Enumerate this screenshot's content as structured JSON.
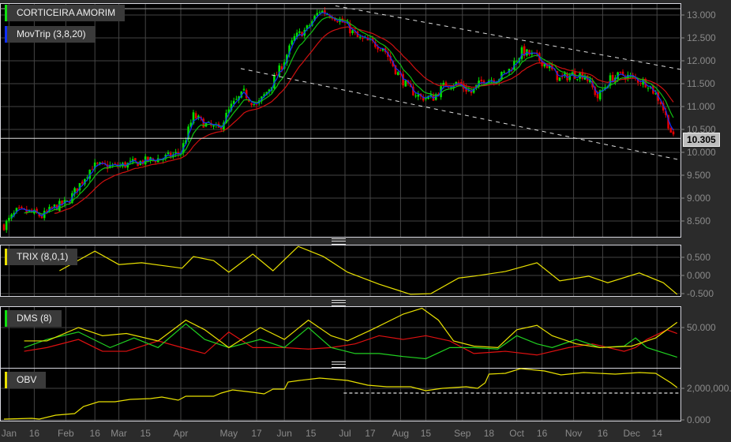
{
  "legends": {
    "main": "CORTICEIRA AMORIM",
    "movtrip": "MovTrip (3,8,20)",
    "trix": "TRIX (8,0,1)",
    "dms": "DMS (8)",
    "obv": "OBV"
  },
  "last_price": "10.305",
  "colors": {
    "up": "#00e000",
    "down": "#e00000",
    "ema_fast": "#1030ff",
    "ema_mid": "#10c010",
    "ema_slow": "#d01010",
    "trix": "#e8e000",
    "dms_plus": "#20d020",
    "dms_minus": "#e01010",
    "adx": "#e8e000",
    "obv": "#e8e000"
  },
  "chart_data": [
    {
      "type": "candlestick",
      "title": "CORTICEIRA AMORIM",
      "x_unit": "week",
      "ylim": [
        8.2,
        13.3
      ],
      "yticks": [
        "13.000",
        "12.500",
        "12.000",
        "11.500",
        "11.000",
        "10.500",
        "10.000",
        "9.500",
        "9.000",
        "8.500"
      ],
      "ytick_values": [
        13,
        12.5,
        12,
        11.5,
        11,
        10.5,
        10,
        9.5,
        9,
        8.5
      ],
      "xticks": [
        "Jan",
        "16",
        "Feb",
        "16",
        "Mar",
        "15",
        "Apr",
        "May",
        "17",
        "Jun",
        "15",
        "Jul",
        "17",
        "Aug",
        "15",
        "Sep",
        "18",
        "Oct",
        "16",
        "Nov",
        "16",
        "Dec",
        "14"
      ],
      "xtick_weeks": [
        0.4,
        2.4,
        4.9,
        7.2,
        9.1,
        11.2,
        14,
        17.8,
        20,
        22.2,
        24.3,
        27,
        29,
        31.4,
        33.4,
        36.3,
        38.4,
        40.6,
        42.6,
        45.1,
        47.4,
        49.7,
        51.7
      ],
      "weekly_close": [
        8.4,
        8.7,
        8.7,
        8.6,
        8.8,
        8.9,
        9.3,
        9.7,
        9.7,
        9.7,
        9.75,
        9.8,
        9.85,
        9.9,
        10.0,
        10.8,
        10.6,
        10.5,
        11.0,
        11.3,
        11.0,
        11.4,
        11.9,
        12.5,
        12.7,
        13.1,
        13.0,
        12.8,
        12.5,
        12.4,
        12.3,
        11.8,
        11.4,
        11.2,
        11.2,
        11.5,
        11.5,
        11.3,
        11.6,
        11.6,
        11.8,
        12.2,
        12.1,
        11.9,
        11.6,
        11.7,
        11.7,
        11.2,
        11.6,
        11.7,
        11.6,
        11.5,
        11.1,
        10.3
      ],
      "moving_averages": [
        "EMA 3",
        "EMA 8",
        "EMA 20"
      ],
      "trendlines": [
        {
          "name": "upper",
          "from": [
            26.25,
            13.2
          ],
          "to": [
            53.6,
            11.81
          ]
        },
        {
          "name": "lower",
          "from": [
            18.75,
            11.83
          ],
          "to": [
            53.6,
            9.83
          ]
        }
      ]
    },
    {
      "type": "line",
      "title": "TRIX (8,0,1)",
      "ylim": [
        -0.55,
        0.85
      ],
      "yticks": [
        "0.500",
        "0.000",
        "-0.500"
      ],
      "ytick_values": [
        0.5,
        0,
        -0.5
      ],
      "points": [
        [
          4.4,
          0.13
        ],
        [
          7.2,
          0.67
        ],
        [
          9.1,
          0.3
        ],
        [
          10.9,
          0.35
        ],
        [
          14.1,
          0.2
        ],
        [
          15,
          0.52
        ],
        [
          16.6,
          0.41
        ],
        [
          17.8,
          0.09
        ],
        [
          19.7,
          0.59
        ],
        [
          21.3,
          0.13
        ],
        [
          23.3,
          0.8
        ],
        [
          25.3,
          0.52
        ],
        [
          27.2,
          0.09
        ],
        [
          29.7,
          -0.24
        ],
        [
          32.2,
          -0.52
        ],
        [
          33.8,
          -0.5
        ],
        [
          36,
          -0.07
        ],
        [
          37.2,
          -0.02
        ],
        [
          39.7,
          0.11
        ],
        [
          42.2,
          0.35
        ],
        [
          44,
          -0.15
        ],
        [
          46.3,
          -0.02
        ],
        [
          47.8,
          -0.2
        ],
        [
          50.3,
          0.07
        ],
        [
          52.2,
          -0.2
        ],
        [
          53.3,
          -0.52
        ]
      ]
    },
    {
      "type": "line",
      "title": "DMS (8)",
      "ylim": [
        0,
        78
      ],
      "yticks": [
        "50.000"
      ],
      "ytick_values": [
        50
      ],
      "series": [
        {
          "name": "ADX",
          "points": [
            [
              1.6,
              32
            ],
            [
              3.4,
              32
            ],
            [
              5.9,
              50
            ],
            [
              7.8,
              39
            ],
            [
              9.7,
              42
            ],
            [
              12.2,
              32
            ],
            [
              14.4,
              60
            ],
            [
              15.9,
              47
            ],
            [
              17.8,
              23
            ],
            [
              20.3,
              50
            ],
            [
              22.2,
              34
            ],
            [
              24.1,
              60
            ],
            [
              25.9,
              39
            ],
            [
              27.2,
              32
            ],
            [
              29.1,
              47
            ],
            [
              31.6,
              68
            ],
            [
              33.1,
              76
            ],
            [
              34.4,
              60
            ],
            [
              35.6,
              32
            ],
            [
              37.2,
              25
            ],
            [
              39.1,
              23
            ],
            [
              40.6,
              47
            ],
            [
              42.2,
              53
            ],
            [
              43.4,
              39
            ],
            [
              45.3,
              28
            ],
            [
              47.2,
              23
            ],
            [
              49.7,
              25
            ],
            [
              51.6,
              36
            ],
            [
              53.3,
              57
            ]
          ]
        },
        {
          "name": "+DI",
          "points": [
            [
              1.6,
              23
            ],
            [
              3.4,
              34
            ],
            [
              5.9,
              44
            ],
            [
              8.4,
              23
            ],
            [
              10.3,
              36
            ],
            [
              12.2,
              23
            ],
            [
              14.4,
              55
            ],
            [
              15.9,
              34
            ],
            [
              17.8,
              23
            ],
            [
              20.3,
              34
            ],
            [
              22.2,
              23
            ],
            [
              24.1,
              50
            ],
            [
              25.9,
              23
            ],
            [
              27.8,
              15
            ],
            [
              29.7,
              15
            ],
            [
              31.6,
              11
            ],
            [
              33.4,
              8
            ],
            [
              35.3,
              23
            ],
            [
              37.2,
              23
            ],
            [
              39.1,
              21
            ],
            [
              40.6,
              39
            ],
            [
              42.2,
              28
            ],
            [
              43.4,
              23
            ],
            [
              45.3,
              34
            ],
            [
              47.2,
              23
            ],
            [
              49.1,
              25
            ],
            [
              50,
              36
            ],
            [
              50.9,
              23
            ],
            [
              53.3,
              10
            ]
          ]
        },
        {
          "name": "-DI",
          "points": [
            [
              1.6,
              18
            ],
            [
              3.4,
              23
            ],
            [
              5.9,
              34
            ],
            [
              7.8,
              18
            ],
            [
              9.7,
              18
            ],
            [
              12.2,
              32
            ],
            [
              14.1,
              23
            ],
            [
              15.9,
              15
            ],
            [
              17.8,
              44
            ],
            [
              19.7,
              23
            ],
            [
              22.2,
              23
            ],
            [
              24.1,
              21
            ],
            [
              25.9,
              23
            ],
            [
              27.8,
              28
            ],
            [
              29.7,
              39
            ],
            [
              31.6,
              34
            ],
            [
              33.4,
              39
            ],
            [
              35.3,
              32
            ],
            [
              37.2,
              15
            ],
            [
              39.7,
              18
            ],
            [
              42.2,
              13
            ],
            [
              44.7,
              23
            ],
            [
              46.6,
              28
            ],
            [
              49.1,
              18
            ],
            [
              50,
              23
            ],
            [
              50.9,
              34
            ],
            [
              52.5,
              47
            ],
            [
              53.3,
              42
            ]
          ]
        }
      ]
    },
    {
      "type": "line",
      "title": "OBV",
      "ylim": [
        0,
        3.3
      ],
      "y_unit": "millions",
      "yticks": [
        "2,000,000.0",
        "0.000"
      ],
      "ytick_values": [
        2,
        0
      ],
      "reference_level": 1.7,
      "reference_from_week": 26.9,
      "points": [
        [
          0,
          0.05
        ],
        [
          2.2,
          0.1
        ],
        [
          2.8,
          0.05
        ],
        [
          4.1,
          0.3
        ],
        [
          5.6,
          0.4
        ],
        [
          6.3,
          0.85
        ],
        [
          7.5,
          1.15
        ],
        [
          8.8,
          1.15
        ],
        [
          10,
          1.3
        ],
        [
          11.6,
          1.35
        ],
        [
          12.5,
          1.45
        ],
        [
          13.8,
          1.25
        ],
        [
          14.4,
          1.5
        ],
        [
          16.6,
          1.5
        ],
        [
          17.2,
          1.7
        ],
        [
          18.1,
          1.9
        ],
        [
          19.7,
          1.75
        ],
        [
          20.6,
          1.65
        ],
        [
          21.3,
          1.95
        ],
        [
          22.2,
          1.95
        ],
        [
          22.5,
          2.4
        ],
        [
          23.4,
          2.5
        ],
        [
          25,
          2.65
        ],
        [
          27.2,
          2.5
        ],
        [
          28.8,
          2.2
        ],
        [
          30.3,
          2.1
        ],
        [
          32.2,
          2.1
        ],
        [
          33.4,
          1.85
        ],
        [
          34.7,
          2.0
        ],
        [
          36.6,
          2.1
        ],
        [
          37.5,
          2.0
        ],
        [
          38.1,
          2.35
        ],
        [
          38.4,
          2.9
        ],
        [
          39.7,
          2.95
        ],
        [
          40.9,
          3.25
        ],
        [
          42.8,
          3.1
        ],
        [
          44.1,
          2.85
        ],
        [
          45.9,
          3.0
        ],
        [
          48.4,
          2.9
        ],
        [
          50.3,
          3.0
        ],
        [
          51.6,
          2.95
        ],
        [
          52.8,
          2.35
        ],
        [
          53.3,
          2.05
        ]
      ]
    }
  ]
}
